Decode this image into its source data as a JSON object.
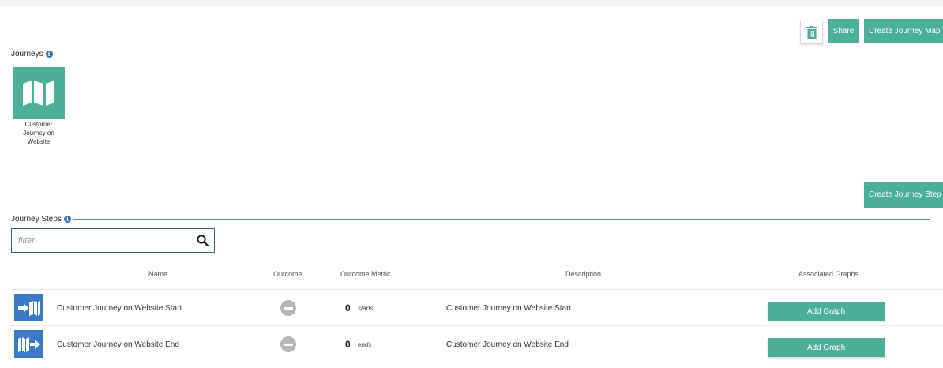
{
  "toolbar": {
    "share_label": "Share",
    "create_map_label": "Create Journey Map"
  },
  "journeys": {
    "section_label": "Journeys",
    "items": [
      {
        "label": "Customer Journey on Website",
        "icon": "map-icon"
      }
    ]
  },
  "steps": {
    "create_label": "Create Journey Step",
    "section_label": "Journey Steps",
    "filter_placeholder": "filter",
    "columns": {
      "name": "Name",
      "outcome": "Outcome",
      "metric": "Outcome Metric",
      "description": "Description",
      "graphs": "Associated Graphs"
    },
    "rows": [
      {
        "icon": "journey-start-icon",
        "name": "Customer Journey on Website Start",
        "metric_value": "0",
        "metric_unit": "starts",
        "description": "Customer Journey on Website Start",
        "action_label": "Add Graph"
      },
      {
        "icon": "journey-end-icon",
        "name": "Customer Journey on Website End",
        "metric_value": "0",
        "metric_unit": "ends",
        "description": "Customer Journey on Website End",
        "action_label": "Add Graph"
      }
    ]
  },
  "colors": {
    "accent": "#4caf97",
    "step_icon": "#3b7ac6",
    "rule": "#5b8db8",
    "info": "#2f6fb5"
  }
}
